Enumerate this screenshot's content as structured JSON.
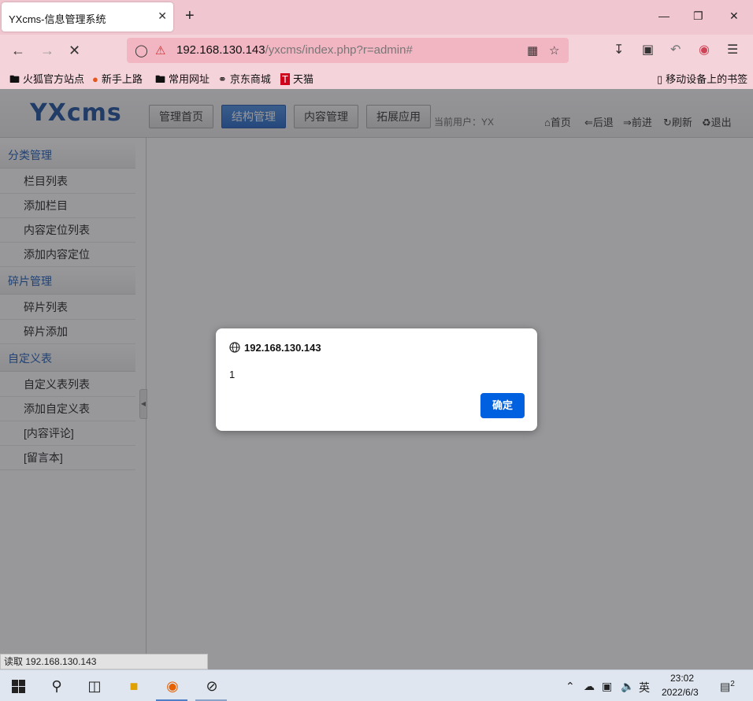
{
  "browser": {
    "tab_title": "YXcms-信息管理系统",
    "tab_close": "✕",
    "new_tab": "+",
    "url_host": "192.168.130.143",
    "url_path": "/yxcms/index.php?r=admin#",
    "bookmarks": [
      "火狐官方站点",
      "新手上路",
      "常用网址",
      "京东商城",
      "天猫"
    ],
    "mobile_bookmarks": "移动设备上的书签"
  },
  "app": {
    "logo": "YXcms",
    "top_buttons": [
      "管理首页",
      "结构管理",
      "内容管理",
      "拓展应用"
    ],
    "current_user": "当前用户：YX",
    "top_links": [
      "首页",
      "后退",
      "前进",
      "刷新",
      "退出"
    ]
  },
  "sidebar": {
    "sections": [
      {
        "title": "分类管理",
        "items": [
          "栏目列表",
          "添加栏目",
          "内容定位列表",
          "添加内容定位"
        ]
      },
      {
        "title": "碎片管理",
        "items": [
          "碎片列表",
          "碎片添加"
        ]
      },
      {
        "title": "自定义表",
        "items": [
          "自定义表列表",
          "添加自定义表",
          "[内容评论]",
          "[留言本]"
        ]
      }
    ]
  },
  "status_text": "读取 192.168.130.143",
  "dialog": {
    "title": "192.168.130.143",
    "message": "1",
    "ok_label": "确定"
  },
  "taskbar": {
    "time": "23:02",
    "date": "2022/6/3",
    "ime": "英",
    "notif_count": "2"
  },
  "colors": {
    "tab_strip": "#f0c6d0",
    "toolbar": "#f5d3db",
    "accent": "#0061e0",
    "app_blue": "#1b5ab3"
  }
}
